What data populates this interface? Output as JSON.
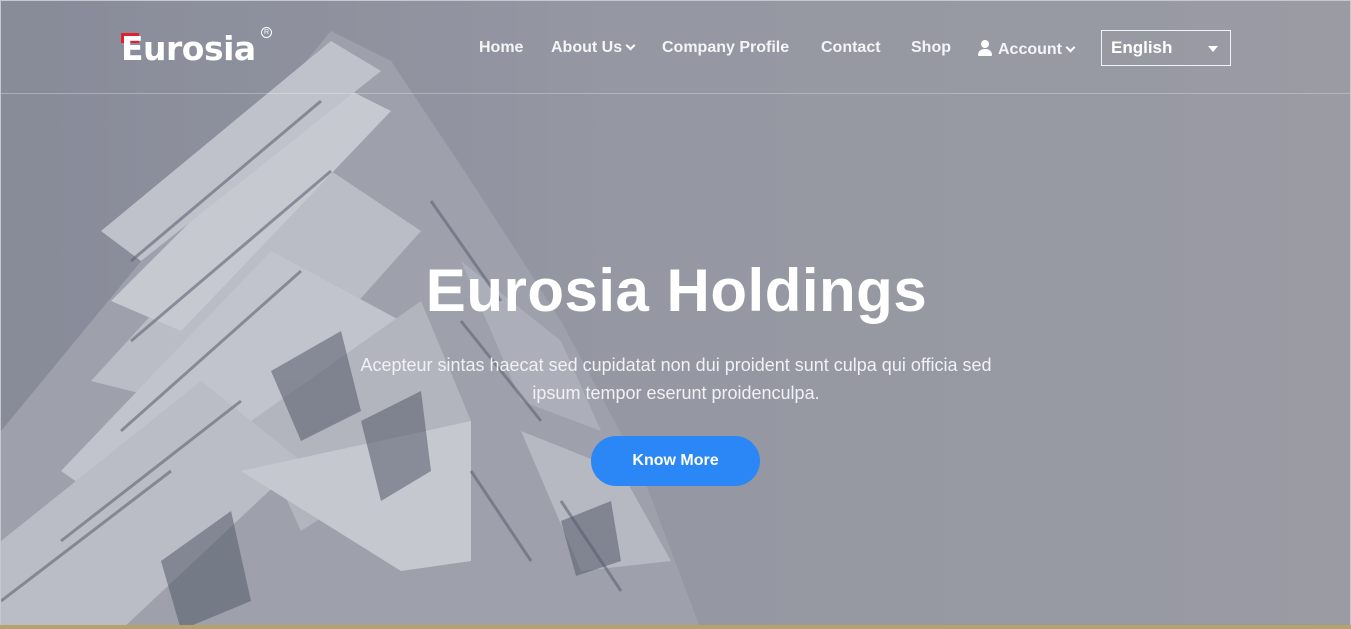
{
  "brand": {
    "logo_text": "Eurosia",
    "registered": "R",
    "accent_color": "#e4202e"
  },
  "nav": {
    "home": "Home",
    "about": "About Us",
    "company_profile": "Company Profile",
    "contact": "Contact",
    "shop": "Shop",
    "account": "Account",
    "language": {
      "selected": "English"
    }
  },
  "hero": {
    "title": "Eurosia Holdings",
    "subtitle_line1": "Acepteur sintas haecat sed cupidatat non dui proident sunt culpa qui officia sed",
    "subtitle_line2": "ipsum tempor eserunt proidenculpa.",
    "cta_label": "Know More",
    "cta_color": "#2b87f5"
  },
  "icons": [
    "user-icon",
    "chevron-down-icon",
    "caret-down-icon"
  ]
}
